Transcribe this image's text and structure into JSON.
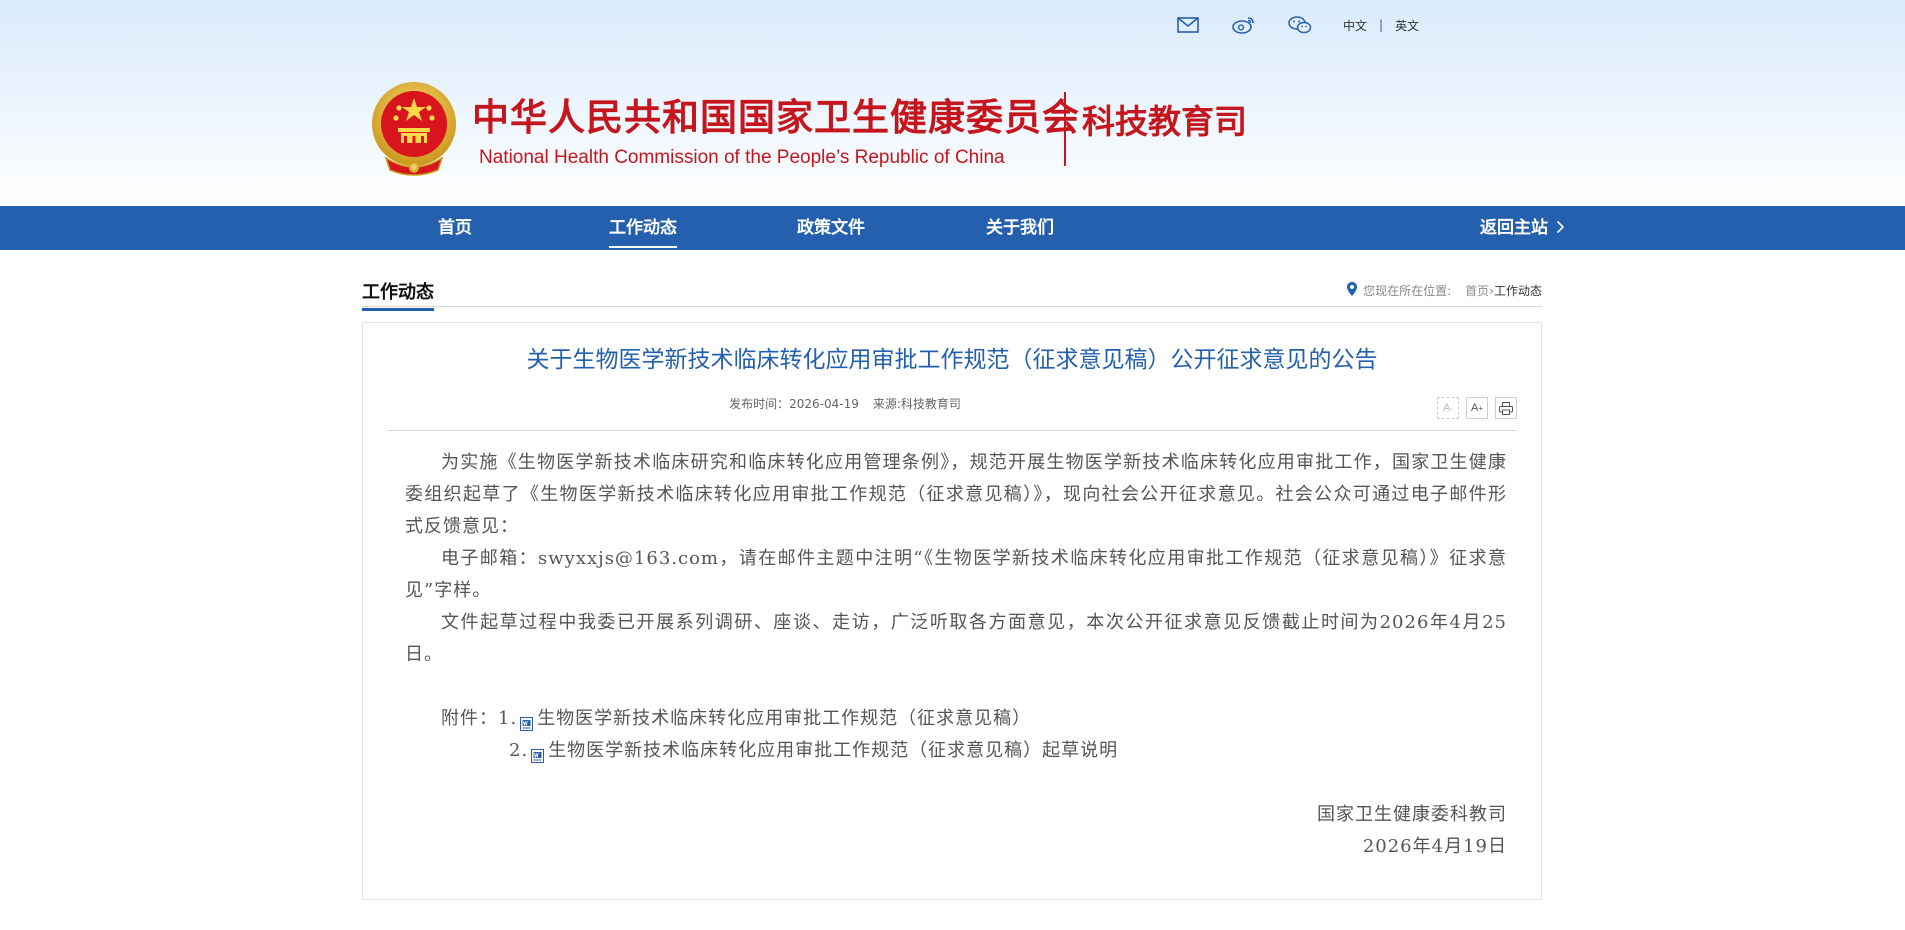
{
  "topbar": {
    "icons": [
      "mail-icon",
      "weibo-icon",
      "wechat-icon"
    ],
    "lang_cn": "中文",
    "lang_sep": "|",
    "lang_en": "英文"
  },
  "header": {
    "title_cn": "中华人民共和国国家卫生健康委员会",
    "title_en": "National Health Commission of the People’s  Republic of China",
    "department": "科技教育司"
  },
  "nav": {
    "items": [
      {
        "label": "首页",
        "active": false
      },
      {
        "label": "工作动态",
        "active": true
      },
      {
        "label": "政策文件",
        "active": false
      },
      {
        "label": "关于我们",
        "active": false
      }
    ],
    "return_label": "返回主站"
  },
  "section": {
    "title": "工作动态",
    "breadcrumb_prefix": "您现在所在位置:",
    "breadcrumb_home": "首页",
    "breadcrumb_sep": "›",
    "breadcrumb_current": "工作动态"
  },
  "article": {
    "title": "关于生物医学新技术临床转化应用审批工作规范（征求意见稿）公开征求意见的公告",
    "date_label": "发布时间：",
    "date": "2026-04-19",
    "source_label": "来源:",
    "source": "科技教育司",
    "tools": {
      "font_smaller": "A",
      "font_larger": "A"
    },
    "paragraphs": [
      "为实施《生物医学新技术临床研究和临床转化应用管理条例》，规范开展生物医学新技术临床转化应用审批工作，国家卫生健康委组织起草了《生物医学新技术临床转化应用审批工作规范（征求意见稿）》，现向社会公开征求意见。社会公众可通过电子邮件形式反馈意见：",
      "电子邮箱：swyxxjs@163.com，请在邮件主题中注明“《生物医学新技术临床转化应用审批工作规范（征求意见稿）》征求意见”字样。",
      "文件起草过程中我委已开展系列调研、座谈、走访，广泛听取各方面意见，本次公开征求意见反馈截止时间为2026年4月25日。"
    ],
    "attachments_label": "附件：",
    "attachments": [
      {
        "num": "1.",
        "name": "生物医学新技术临床转化应用审批工作规范（征求意见稿）"
      },
      {
        "num": "2.",
        "name": "生物医学新技术临床转化应用审批工作规范（征求意见稿）起草说明"
      }
    ],
    "signature": "国家卫生健康委科教司",
    "signature_date": "2026年4月19日"
  },
  "colors": {
    "brand_red": "#c4161c",
    "nav_blue": "#2460ad",
    "title_blue": "#2460ad"
  }
}
